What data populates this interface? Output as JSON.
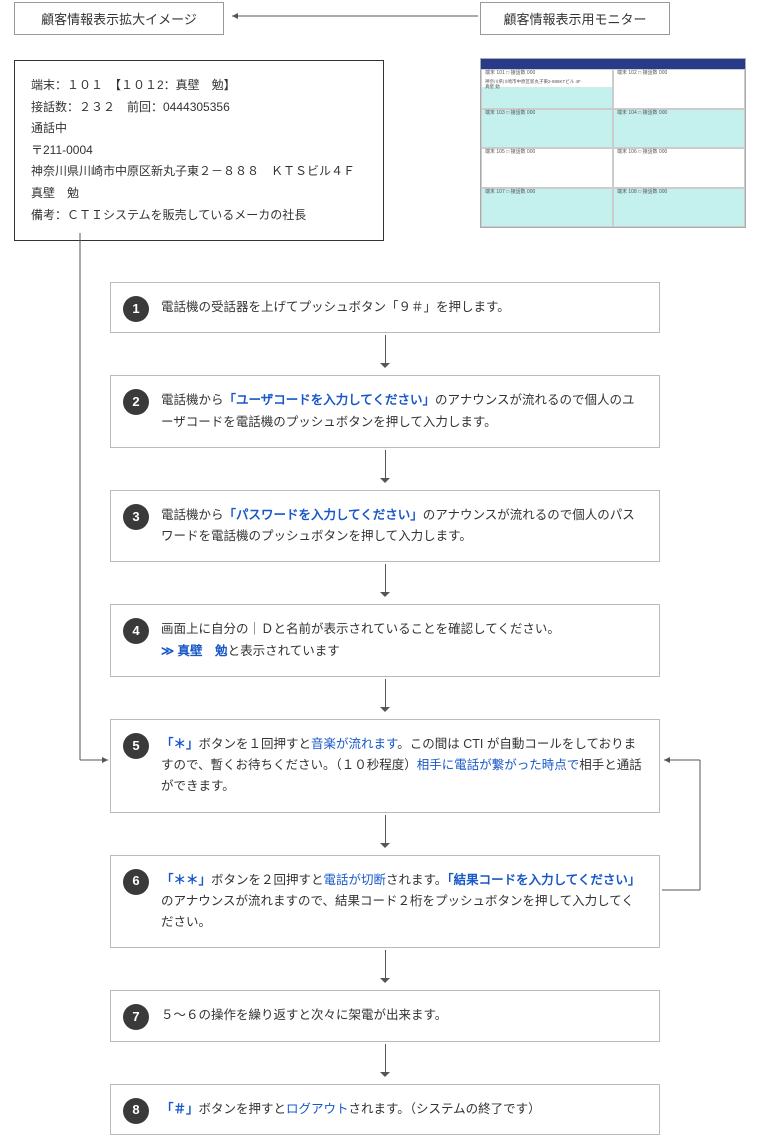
{
  "header": {
    "left_box": "顧客情報表示拡大イメージ",
    "right_box": "顧客情報表示用モニター"
  },
  "detail": {
    "line1": "端末：１０１　【１０１2：真壁　勉】",
    "line2": "接話数：２３２　前回：0444305356",
    "line3": "通話中",
    "line4": "〒211-0004",
    "line5": "神奈川県川崎市中原区新丸子東２－８８８　ＫＴＳビル４Ｆ",
    "line6": "真壁　勉",
    "line7": "備考：ＣＴＩシステムを販売しているメーカの社長"
  },
  "monitor": {
    "cells": [
      {
        "label": "端末 101 □ 接話数 000",
        "extra": "神奈川県川崎市中原区新丸子東2-888KTビル 4F\n真壁 勉"
      },
      {
        "label": "端末 102 □ 接話数 000"
      },
      {
        "label": "端末 103 □ 接話数 000"
      },
      {
        "label": "端末 104 □ 接話数 000"
      },
      {
        "label": "端末 105 □ 接話数 000"
      },
      {
        "label": "端末 106 □ 接話数 000"
      },
      {
        "label": "端末 107 □ 接話数 000"
      },
      {
        "label": "端末 108 □ 接話数 000"
      }
    ]
  },
  "steps": [
    {
      "n": "1",
      "parts": [
        {
          "t": "電話機の受話器を上げてプッシュボタン「９＃」を押します。"
        }
      ]
    },
    {
      "n": "2",
      "parts": [
        {
          "t": "電話機から"
        },
        {
          "t": "「ユーザコードを入力してください」",
          "c": "blue-bold"
        },
        {
          "t": "のアナウンスが流れるので個人のユーザコードを電話機のプッシュボタンを押して入力します。"
        }
      ]
    },
    {
      "n": "3",
      "parts": [
        {
          "t": "電話機から"
        },
        {
          "t": "「パスワードを入力してください」",
          "c": "blue-bold"
        },
        {
          "t": "のアナウンスが流れるので個人のパスワードを電話機のプッシュボタンを押して入力します。"
        }
      ]
    },
    {
      "n": "4",
      "parts": [
        {
          "t": "画面上に自分の｜Ｄと名前が表示されていることを確認してください。"
        },
        {
          "br": true
        },
        {
          "t": "≫ 真壁　勉",
          "c": "blue-bold"
        },
        {
          "t": "と表示されています"
        }
      ]
    },
    {
      "n": "5",
      "parts": [
        {
          "t": "「＊」",
          "c": "blue-bold"
        },
        {
          "t": "ボタンを１回押すと"
        },
        {
          "t": "音楽が流れます",
          "c": "blue"
        },
        {
          "t": "。この間は CTI が自動コールをしておりますので、暫くお待ちください。（１０秒程度）"
        },
        {
          "t": "相手に電話が繋がった時点で",
          "c": "blue"
        },
        {
          "t": "相手と通話ができます。"
        }
      ]
    },
    {
      "n": "6",
      "parts": [
        {
          "t": "「＊＊」",
          "c": "blue-bold"
        },
        {
          "t": "ボタンを２回押すと"
        },
        {
          "t": "電話が切断",
          "c": "blue"
        },
        {
          "t": "されます。"
        },
        {
          "t": "「結果コードを入力してください」",
          "c": "blue-bold"
        },
        {
          "t": "のアナウンスが流れますので、結果コード２桁をプッシュボタンを押して入力してください。"
        }
      ]
    },
    {
      "n": "7",
      "parts": [
        {
          "t": "５～６の操作を繰り返すと次々に架電が出来ます。"
        }
      ]
    },
    {
      "n": "8",
      "parts": [
        {
          "t": "「＃」",
          "c": "blue-bold"
        },
        {
          "t": "ボタンを押すと"
        },
        {
          "t": "ログアウト",
          "c": "blue"
        },
        {
          "t": "されます。（システムの終了です）"
        }
      ]
    }
  ]
}
